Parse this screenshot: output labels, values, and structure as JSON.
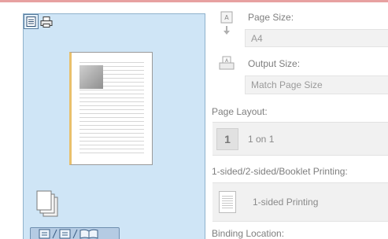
{
  "preview": {
    "icons": [
      "page-view-icon",
      "printer-view-icon",
      "stack-pages-icon",
      "binding-location-icon"
    ]
  },
  "settings": {
    "page_size": {
      "label": "Page Size:",
      "value": "A4",
      "icon": "page-size-icon"
    },
    "output_size": {
      "label": "Output Size:",
      "value": "Match Page Size",
      "icon": "output-size-icon"
    },
    "page_layout": {
      "label": "Page Layout:",
      "number": "1",
      "value": "1 on 1"
    },
    "printing": {
      "label": "1-sided/2-sided/Booklet Printing:",
      "value": "1-sided Printing"
    },
    "binding": {
      "label": "Binding Location:"
    }
  },
  "colors": {
    "preview_bg": "#cfe5f6",
    "accent": "#e7a1a1"
  }
}
